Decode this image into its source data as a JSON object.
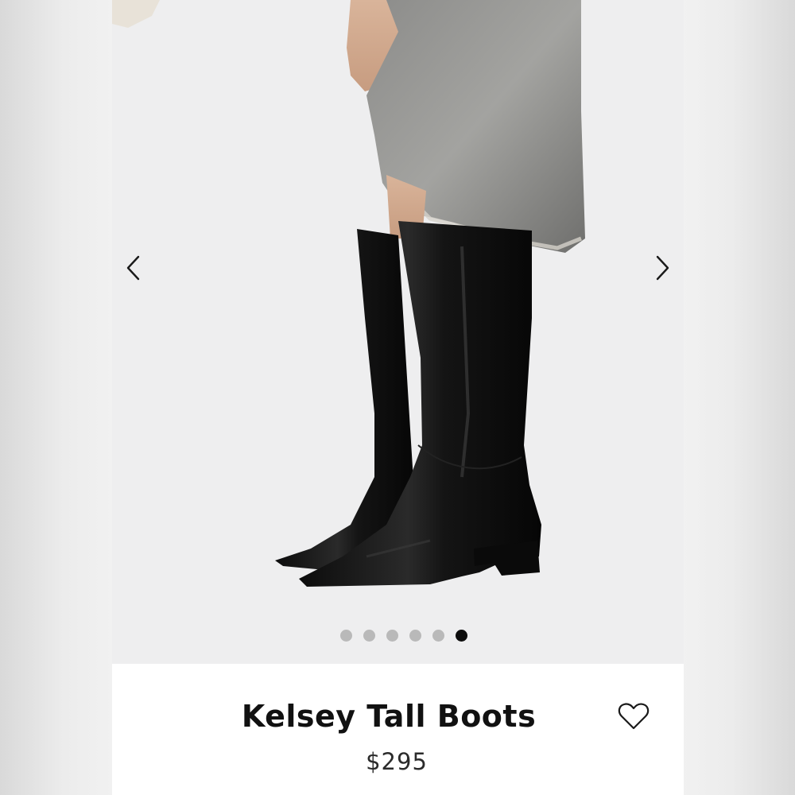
{
  "gallery": {
    "prev_icon": "chevron-left-icon",
    "next_icon": "chevron-right-icon",
    "image_count": 6,
    "active_index": 6
  },
  "product": {
    "title": "Kelsey Tall Boots",
    "price": "$295",
    "favorite_icon": "heart-outline-icon"
  },
  "colors": {
    "accent": "#0d0d0d",
    "dot_inactive": "#b9b9b9",
    "background": "#ffffff"
  }
}
